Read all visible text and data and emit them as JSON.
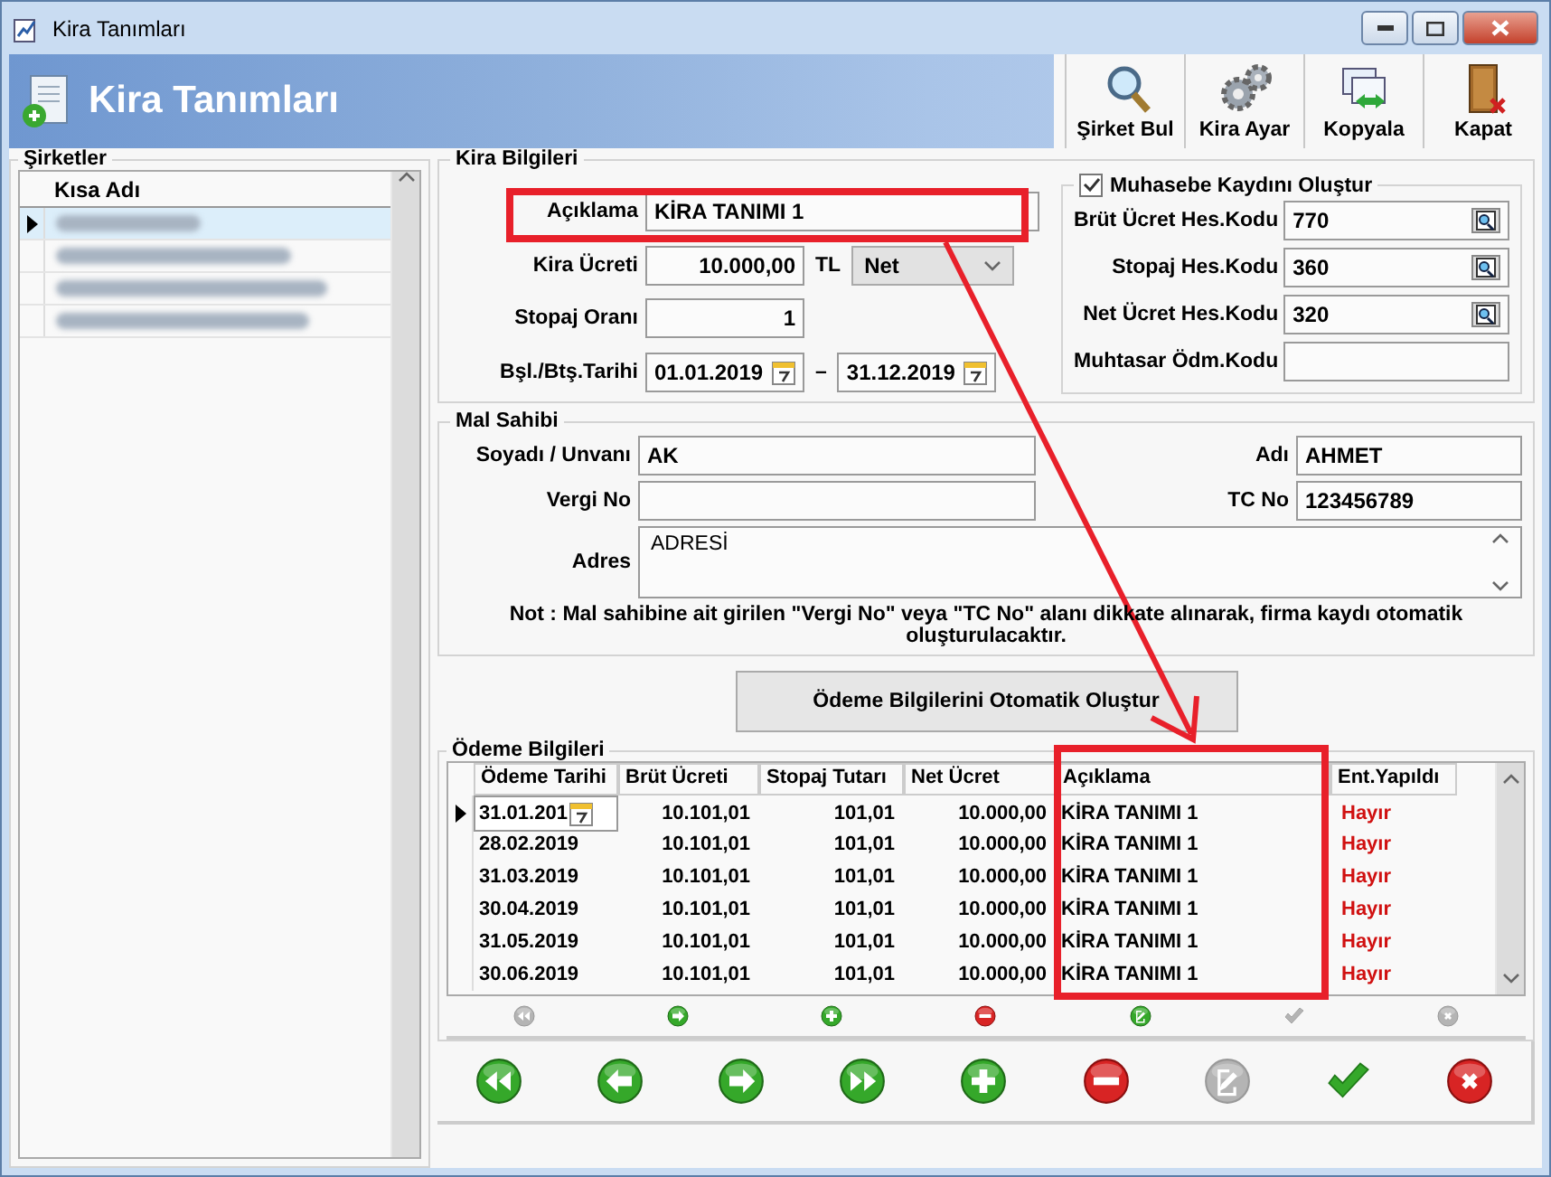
{
  "window": {
    "title": "Kira Tanımları"
  },
  "header": {
    "title": "Kira Tanımları"
  },
  "toolbar": [
    {
      "label": "Şirket Bul",
      "kind": "search"
    },
    {
      "label": "Kira Ayar",
      "kind": "gears"
    },
    {
      "label": "Kopyala",
      "kind": "copy"
    },
    {
      "label": "Kapat",
      "kind": "exit"
    }
  ],
  "companies": {
    "title": "Şirketler",
    "column": "Kısa Adı",
    "rows": [
      {
        "selected": true
      },
      {
        "selected": false
      },
      {
        "selected": false
      },
      {
        "selected": false
      }
    ]
  },
  "rent": {
    "title": "Kira Bilgileri",
    "description": {
      "label": "Açıklama",
      "value": "KİRA TANIMI 1"
    },
    "amount": {
      "label": "Kira Ücreti",
      "value": "10.000,00",
      "currency": "TL",
      "type": "Net"
    },
    "withholding": {
      "label": "Stopaj Oranı",
      "value": "1"
    },
    "dates": {
      "label": "Bşl./Btş.Tarihi",
      "start": "01.01.2019",
      "separator": "–",
      "end": "31.12.2019"
    },
    "accounting": {
      "label": "Muhasebe Kaydını Oluştur",
      "checked": true,
      "fields": [
        {
          "label": "Brüt Ücret Hes.Kodu",
          "value": "770",
          "lookup": true
        },
        {
          "label": "Stopaj Hes.Kodu",
          "value": "360",
          "lookup": true
        },
        {
          "label": "Net Ücret Hes.Kodu",
          "value": "320",
          "lookup": true
        },
        {
          "label": "Muhtasar Ödm.Kodu",
          "lookup": false
        }
      ]
    }
  },
  "owner": {
    "title": "Mal Sahibi",
    "surname": {
      "label": "Soyadı / Unvanı",
      "value": "AK"
    },
    "name": {
      "label": "Adı",
      "value": "AHMET"
    },
    "tax_no": {
      "label": "Vergi No"
    },
    "tc_no": {
      "label": "TC No",
      "value": "123456789"
    },
    "address": {
      "label": "Adres",
      "value": "ADRESİ"
    },
    "note": "Not : Mal sahibine ait girilen \"Vergi No\" veya \"TC No\" alanı dikkate alınarak, firma kaydı otomatik oluşturulacaktır."
  },
  "auto_button": "Ödeme Bilgilerini Otomatik Oluştur",
  "payments": {
    "title": "Ödeme Bilgileri",
    "columns": [
      "Ödeme Tarihi",
      "Brüt Ücreti",
      "Stopaj Tutarı",
      "Net Ücret",
      "Açıklama",
      "Ent.Yapıldı"
    ],
    "rows": [
      {
        "date": "31.01.201",
        "gross": "10.101,01",
        "withholding": "101,01",
        "net": "10.000,00",
        "description": "KİRA TANIMI 1",
        "posted": "Hayır",
        "selected": true
      },
      {
        "date": "28.02.2019",
        "gross": "10.101,01",
        "withholding": "101,01",
        "net": "10.000,00",
        "description": "KİRA TANIMI 1",
        "posted": "Hayır",
        "selected": false
      },
      {
        "date": "31.03.2019",
        "gross": "10.101,01",
        "withholding": "101,01",
        "net": "10.000,00",
        "description": "KİRA TANIMI 1",
        "posted": "Hayır",
        "selected": false
      },
      {
        "date": "30.04.2019",
        "gross": "10.101,01",
        "withholding": "101,01",
        "net": "10.000,00",
        "description": "KİRA TANIMI 1",
        "posted": "Hayır",
        "selected": false
      },
      {
        "date": "31.05.2019",
        "gross": "10.101,01",
        "withholding": "101,01",
        "net": "10.000,00",
        "description": "KİRA TANIMI 1",
        "posted": "Hayır",
        "selected": false
      },
      {
        "date": "30.06.2019",
        "gross": "10.101,01",
        "withholding": "101,01",
        "net": "10.000,00",
        "description": "KİRA TANIMI 1",
        "posted": "Hayır",
        "selected": false
      }
    ]
  },
  "grid_buttons": [
    {
      "kind": "first",
      "disabled": true
    },
    {
      "kind": "next",
      "disabled": false
    },
    {
      "kind": "add",
      "disabled": false
    },
    {
      "kind": "delete",
      "disabled": false
    },
    {
      "kind": "edit",
      "disabled": false
    },
    {
      "kind": "save",
      "disabled": true
    },
    {
      "kind": "cancel",
      "disabled": true
    }
  ],
  "record_buttons": [
    {
      "kind": "first",
      "disabled": false
    },
    {
      "kind": "prev",
      "disabled": false
    },
    {
      "kind": "next",
      "disabled": false
    },
    {
      "kind": "last",
      "disabled": false
    },
    {
      "kind": "add",
      "disabled": false
    },
    {
      "kind": "delete",
      "disabled": false
    },
    {
      "kind": "edit",
      "disabled": true
    },
    {
      "kind": "save",
      "disabled": false
    },
    {
      "kind": "cancel",
      "disabled": false
    }
  ]
}
